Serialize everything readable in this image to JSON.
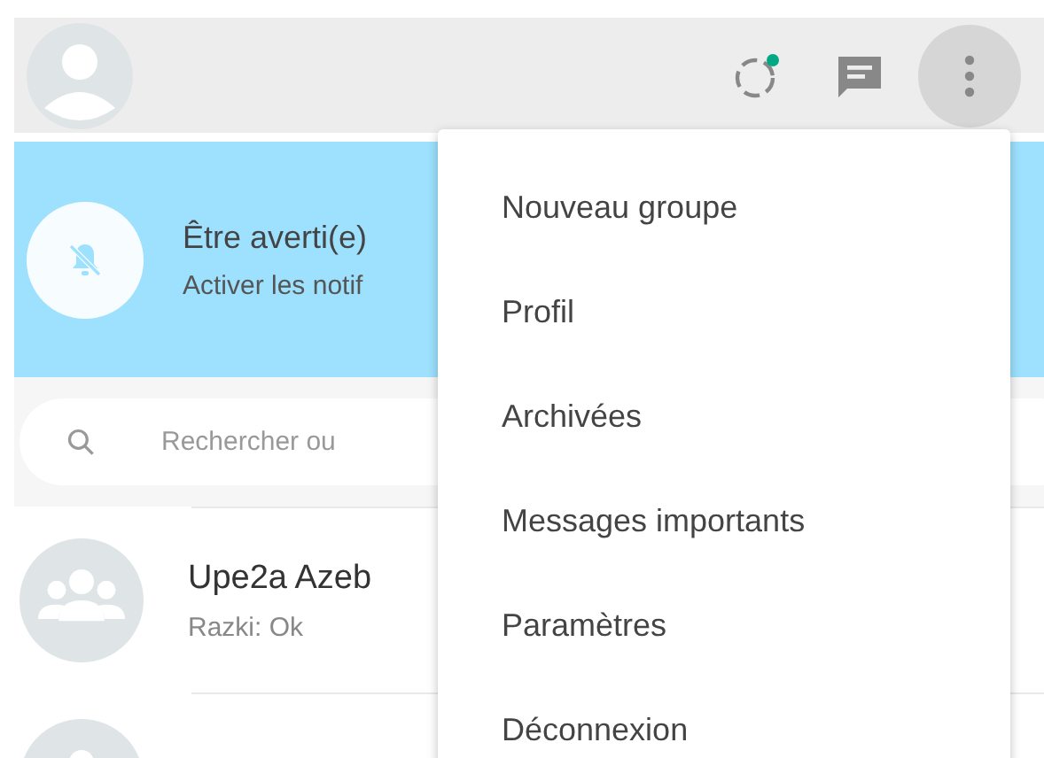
{
  "header": {
    "status_unread": true
  },
  "banner": {
    "title": "Être averti(e)",
    "subtitle": "Activer les notif"
  },
  "search": {
    "placeholder": "Rechercher ou"
  },
  "chats": [
    {
      "kind": "group",
      "name": "Upe2a Azeb",
      "last_message": "Razki: Ok"
    },
    {
      "kind": "group"
    }
  ],
  "menu": {
    "items": [
      "Nouveau groupe",
      "Profil",
      "Archivées",
      "Messages importants",
      "Paramètres",
      "Déconnexion"
    ]
  }
}
